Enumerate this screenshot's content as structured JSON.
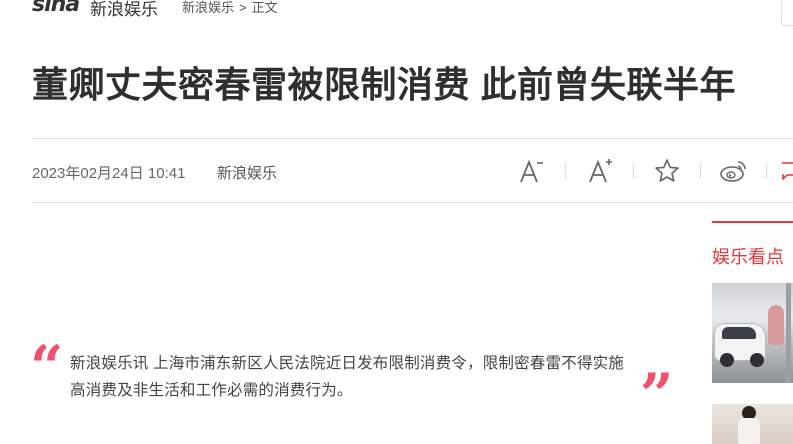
{
  "header": {
    "logo_text": "sina",
    "channel": "新浪娱乐",
    "breadcrumb": [
      "新浪娱乐",
      "正文"
    ],
    "breadcrumb_sep": ">"
  },
  "article": {
    "title": "董卿丈夫密春雷被限制消费 此前曾失联半年",
    "date": "2023年02月24日 10:41",
    "source": "新浪娱乐",
    "quote": "新浪娱乐讯 上海市浦东新区人民法院近日发布限制消费令，限制密春雷不得实施高消费及非生活和工作必需的消费行为。"
  },
  "toolbar": {
    "items": [
      "font-decrease-icon",
      "font-increase-icon",
      "favorite-star-icon",
      "weibo-share-icon",
      "comment-icon"
    ]
  },
  "sidebar": {
    "title": "娱乐看点"
  },
  "colors": {
    "accent": "#e4393c",
    "quote_mark": "#f0506e",
    "title": "#2f2f2f"
  }
}
